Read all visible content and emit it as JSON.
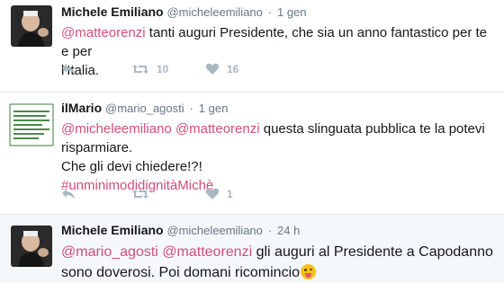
{
  "tweets": [
    {
      "fullname": "Michele Emiliano",
      "handle": "@micheleemiliano",
      "separator": "·",
      "time": "1 gen",
      "body": {
        "mention1": "@matteorenzi",
        "text1": " tanti auguri Presidente, che sia un anno fantastico per te e per",
        "text2": "l'Italia."
      },
      "actions": {
        "reply_icon": "reply-icon",
        "retweet_count": "10",
        "like_count": "16"
      }
    },
    {
      "fullname": "ilMario",
      "handle": "@mario_agosti",
      "separator": "·",
      "time": "1 gen",
      "body": {
        "mention1": "@micheleemiliano",
        "mention2": "@matteorenzi",
        "text1": " questa slinguata pubblica te la potevi",
        "text2": "risparmiare.",
        "text3": "Che gli devi chiedere!?!",
        "hashtag": "#unminimodidignitàMichè"
      },
      "actions": {
        "reply_icon": "reply-icon",
        "retweet_count": "",
        "like_count": "1"
      }
    },
    {
      "fullname": "Michele Emiliano",
      "handle": "@micheleemiliano",
      "separator": "·",
      "time": "24 h",
      "body": {
        "mention1": "@mario_agosti",
        "mention2": "@matteorenzi",
        "text1": " gli auguri al Presidente a Capodanno",
        "text2": "sono doverosi. Poi domani ricomincio",
        "emoji": "stuck-out-tongue-winking-emoji"
      }
    }
  ],
  "colors": {
    "mention": "#d04d7b",
    "mention_alt": "#1d7ab8",
    "action_icon": "#aab8c2",
    "like_heart": "#aab8c2",
    "highlight_bg": "#f5f8fa"
  }
}
